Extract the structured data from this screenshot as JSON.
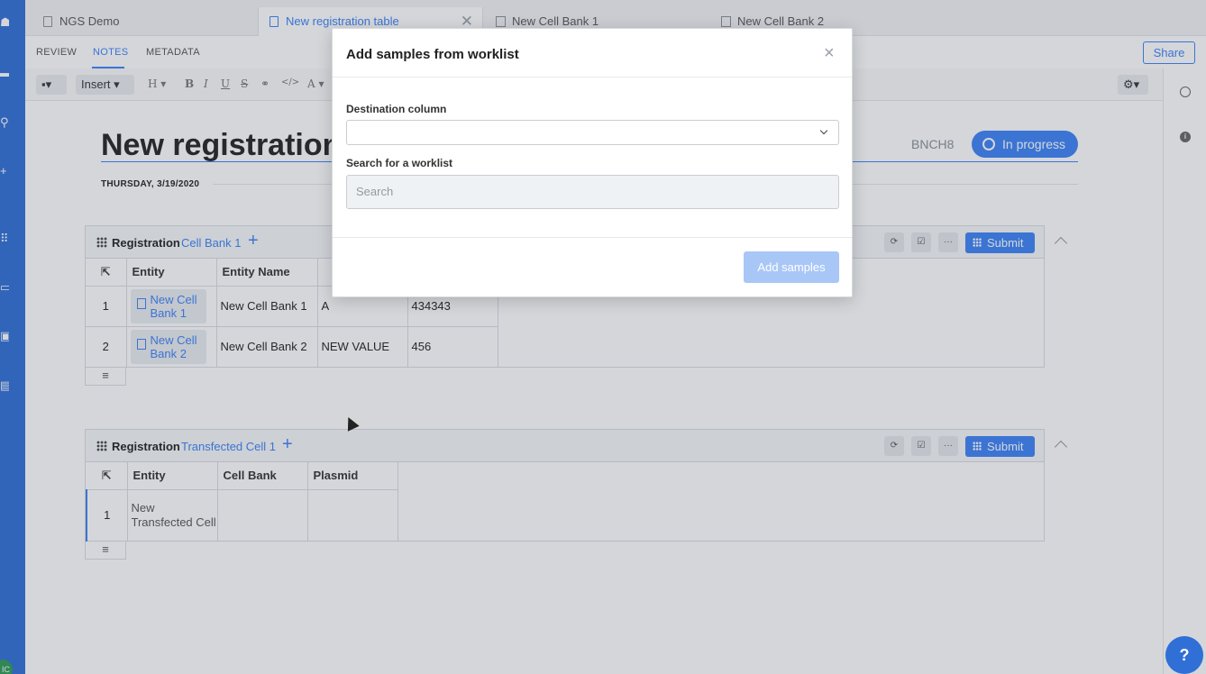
{
  "tabs": [
    {
      "label": "NGS Demo"
    },
    {
      "label": "New registration table"
    },
    {
      "label": "New Cell Bank 1"
    },
    {
      "label": "New Cell Bank 2"
    }
  ],
  "subnav": {
    "review": "REVIEW",
    "notes": "NOTES",
    "metadata": "METADATA",
    "share": "Share"
  },
  "toolbar": {
    "insert": "Insert",
    "heading": "H",
    "bold": "B",
    "italic": "I",
    "underline": "U",
    "strike": "S",
    "font_color": "A"
  },
  "entry": {
    "title": "New registration table",
    "id": "BNCH8",
    "status": "In progress",
    "date": "THURSDAY, 3/19/2020"
  },
  "table1": {
    "label": "Registration",
    "schema": "Cell Bank 1",
    "submit": "Submit",
    "columns": [
      "Entity",
      "Entity Name",
      "",
      ""
    ],
    "rows": [
      {
        "num": "1",
        "entity": "New Cell Bank 1",
        "entity_name": "New Cell Bank 1",
        "col3": "A",
        "col4": "434343"
      },
      {
        "num": "2",
        "entity": "New Cell Bank 2",
        "entity_name": "New Cell Bank 2",
        "col3": "NEW VALUE",
        "col4": "456"
      }
    ],
    "footer": "≡"
  },
  "table2": {
    "label": "Registration",
    "schema": "Transfected Cell 1",
    "submit": "Submit",
    "columns": [
      "Entity",
      "Cell Bank",
      "Plasmid"
    ],
    "rows": [
      {
        "num": "1",
        "entity": "New Transfected Cell",
        "cell_bank": "",
        "plasmid": ""
      }
    ],
    "footer": "≡"
  },
  "modal": {
    "title": "Add samples from worklist",
    "close": "×",
    "destination_label": "Destination column",
    "destination_value": "",
    "search_label": "Search for a worklist",
    "search_placeholder": "Search",
    "add_button": "Add samples"
  },
  "help": "?",
  "colors": {
    "accent": "#3b82f6",
    "rail": "#2f6fd6",
    "add_disabled": "#a9c7f6"
  }
}
